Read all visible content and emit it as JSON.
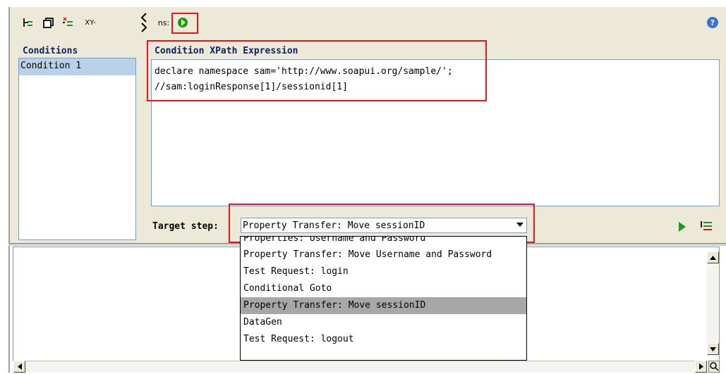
{
  "toolbar": {
    "add_icon": "add-condition-icon",
    "copy_icon": "copy-icon",
    "delete_icon": "delete-condition-icon",
    "xy_label": "XY-",
    "ns_label": "ns:",
    "run_icon": "run-icon",
    "help_icon": "help-icon"
  },
  "conditions": {
    "header": "Conditions",
    "items": [
      "Condition 1"
    ],
    "selected": 0
  },
  "xpath": {
    "header": "Condition XPath Expression",
    "lines": [
      "declare namespace sam='http://www.soapui.org/sample/';",
      "//sam:loginResponse[1]/sessionid[1]"
    ]
  },
  "target": {
    "label": "Target step:",
    "selected": "Property Transfer: Move sessionID",
    "options": [
      "Properties: Username and Password",
      "Property Transfer: Move Username and Password",
      "Test Request: login",
      "Conditional Goto",
      "Property Transfer: Move sessionID",
      "DataGen",
      "Test Request: logout"
    ],
    "highlighted_index": 4
  },
  "colors": {
    "highlight_box": "#e8141c",
    "header_text": "#0a246a",
    "selection": "#b9d1ea",
    "dropdown_selected": "#a7a7a7",
    "run_green": "#1a9a1a"
  }
}
